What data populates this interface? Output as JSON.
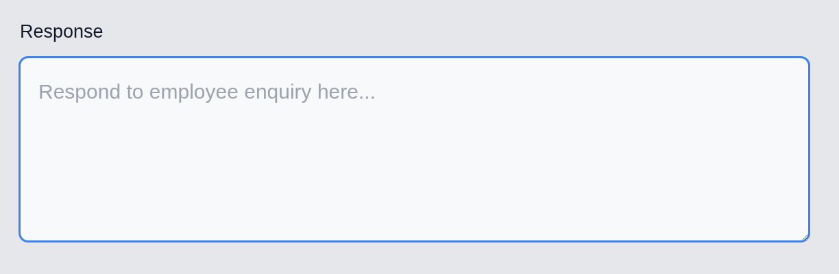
{
  "field": {
    "label": "Response",
    "placeholder": "Respond to employee enquiry here...",
    "focused": true
  }
}
